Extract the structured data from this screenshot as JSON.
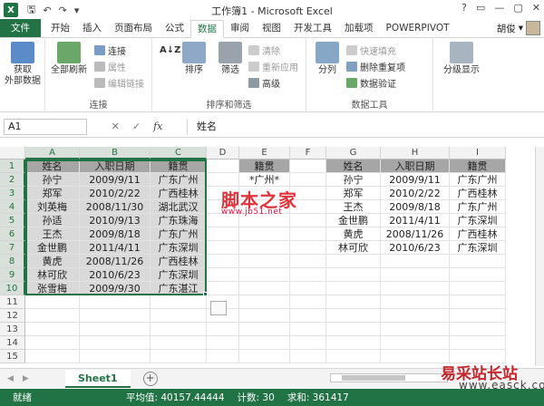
{
  "window": {
    "title": "工作簿1 - Microsoft Excel",
    "app_icon": "X",
    "qat_icons": [
      "save-icon",
      "undo-icon",
      "redo-icon",
      "customize-icon"
    ],
    "controls": [
      "?",
      "▭",
      "—",
      "▢",
      "✕"
    ]
  },
  "tabs": [
    "文件",
    "开始",
    "插入",
    "页面布局",
    "公式",
    "数据",
    "审阅",
    "视图",
    "开发工具",
    "加载项",
    "POWERPIVOT"
  ],
  "active_tab": "数据",
  "user": {
    "name": "胡俊"
  },
  "ribbon": {
    "get_external": {
      "label": "获取",
      "label2": "外部数据"
    },
    "refresh_all": {
      "label": "全部刷新"
    },
    "connections": {
      "connect": "连接",
      "properties": "属性",
      "edit_links": "编辑链接"
    },
    "group_connections": "连接",
    "sort_az": "A↓Z",
    "sort": "排序",
    "filter": "筛选",
    "clear": "清除",
    "reapply": "重新应用",
    "advanced": "高级",
    "group_sort": "排序和筛选",
    "text_to_columns": "分列",
    "flash_fill": "快速填充",
    "remove_dup": "删除重复项",
    "validation": "数据验证",
    "group_tools": "数据工具",
    "outline": "分级显示"
  },
  "formula_bar": {
    "name_box": "A1",
    "cancel": "✕",
    "enter": "✓",
    "fx": "fx",
    "content": "姓名"
  },
  "columns": [
    "A",
    "B",
    "C",
    "D",
    "E",
    "F",
    "G",
    "H",
    "I"
  ],
  "rows": [
    "1",
    "2",
    "3",
    "4",
    "5",
    "6",
    "7",
    "8",
    "9",
    "10",
    "11",
    "12",
    "13",
    "14",
    "15"
  ],
  "table_main": {
    "headers": [
      "姓名",
      "入职日期",
      "籍贯"
    ],
    "rows": [
      [
        "孙宁",
        "2009/9/11",
        "广东广州"
      ],
      [
        "郑军",
        "2010/2/22",
        "广西桂林"
      ],
      [
        "刘英梅",
        "2008/11/30",
        "湖北武汉"
      ],
      [
        "孙适",
        "2010/9/13",
        "广东珠海"
      ],
      [
        "王杰",
        "2009/8/18",
        "广东广州"
      ],
      [
        "金世鹏",
        "2011/4/11",
        "广东深圳"
      ],
      [
        "黄虎",
        "2008/11/26",
        "广西桂林"
      ],
      [
        "林可欣",
        "2010/6/23",
        "广东深圳"
      ],
      [
        "张雪梅",
        "2009/9/30",
        "广东湛江"
      ]
    ]
  },
  "criteria": {
    "header": "籍贯",
    "value": "*广州*"
  },
  "table_result": {
    "headers": [
      "姓名",
      "入职日期",
      "籍贯"
    ],
    "rows": [
      [
        "孙宁",
        "2009/9/11",
        "广东广州"
      ],
      [
        "郑军",
        "2010/2/22",
        "广西桂林"
      ],
      [
        "王杰",
        "2009/8/18",
        "广东广州"
      ],
      [
        "金世鹏",
        "2011/4/11",
        "广东深圳"
      ],
      [
        "黄虎",
        "2008/11/26",
        "广西桂林"
      ],
      [
        "林可欣",
        "2010/6/23",
        "广东深圳"
      ]
    ]
  },
  "watermark": {
    "main": "脚本之家",
    "sub": "www.jb51.net"
  },
  "sheet_tabs": [
    "Sheet1"
  ],
  "add_sheet": "+",
  "status": {
    "ready": "就绪",
    "average": "平均值: 40157.44444",
    "count": "计数: 30",
    "sum": "求和: 361417"
  },
  "site": {
    "name": "易采站长站",
    "url": "www.easck.com"
  },
  "colors": {
    "accent": "#217346",
    "header_fill": "#a6a6a6",
    "data_fill": "#d9d9d9"
  }
}
